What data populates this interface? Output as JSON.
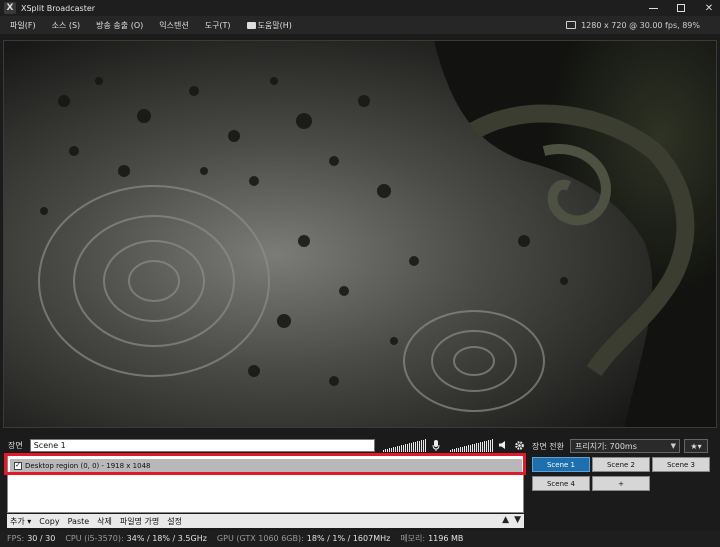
{
  "window": {
    "title": "XSplit Broadcaster",
    "logo_letter": "X",
    "close_glyph": "✕"
  },
  "menu": {
    "items": [
      "파일(F)",
      "소스 (S)",
      "방송 송출 (O)",
      "익스텐션",
      "도구(T)",
      "도움말(H)"
    ],
    "status_text": "1280 x 720 @ 30.00 fps, 89%"
  },
  "scene": {
    "label": "장면",
    "name_value": "Scene 1",
    "mic_icon": "microphone-icon",
    "speaker_icon": "speaker-icon",
    "settings_icon": "gear-icon"
  },
  "sources": {
    "items": [
      {
        "label": "Desktop region (0, 0) - 1918 x 1048",
        "checked": true
      }
    ],
    "toolbar": {
      "add": "추가 ▾",
      "copy": "Copy",
      "paste": "Paste",
      "delete": "삭제",
      "rename": "파일명 가명",
      "settings": "설정",
      "up": "▲",
      "down": "▼"
    }
  },
  "transition": {
    "label": "장면 전환",
    "selected": "프리지기: 700ms",
    "fx_label": "★▾"
  },
  "scenes": {
    "buttons": [
      "Scene 1",
      "Scene 2",
      "Scene 3",
      "Scene 4",
      "+"
    ],
    "active": "Scene 1"
  },
  "status": {
    "fps_label": "FPS:",
    "fps_value": "30 / 30",
    "cpu_label": "CPU (i5-3570):",
    "cpu_value": "34% / 18% / 3.5GHz",
    "gpu_label": "GPU (GTX 1060 6GB):",
    "gpu_value": "18% / 1% / 1607MHz",
    "mem_label": "메모리:",
    "mem_value": "1196 MB"
  },
  "colors": {
    "accent": "#1d6fae",
    "highlight": "#e2192a"
  }
}
